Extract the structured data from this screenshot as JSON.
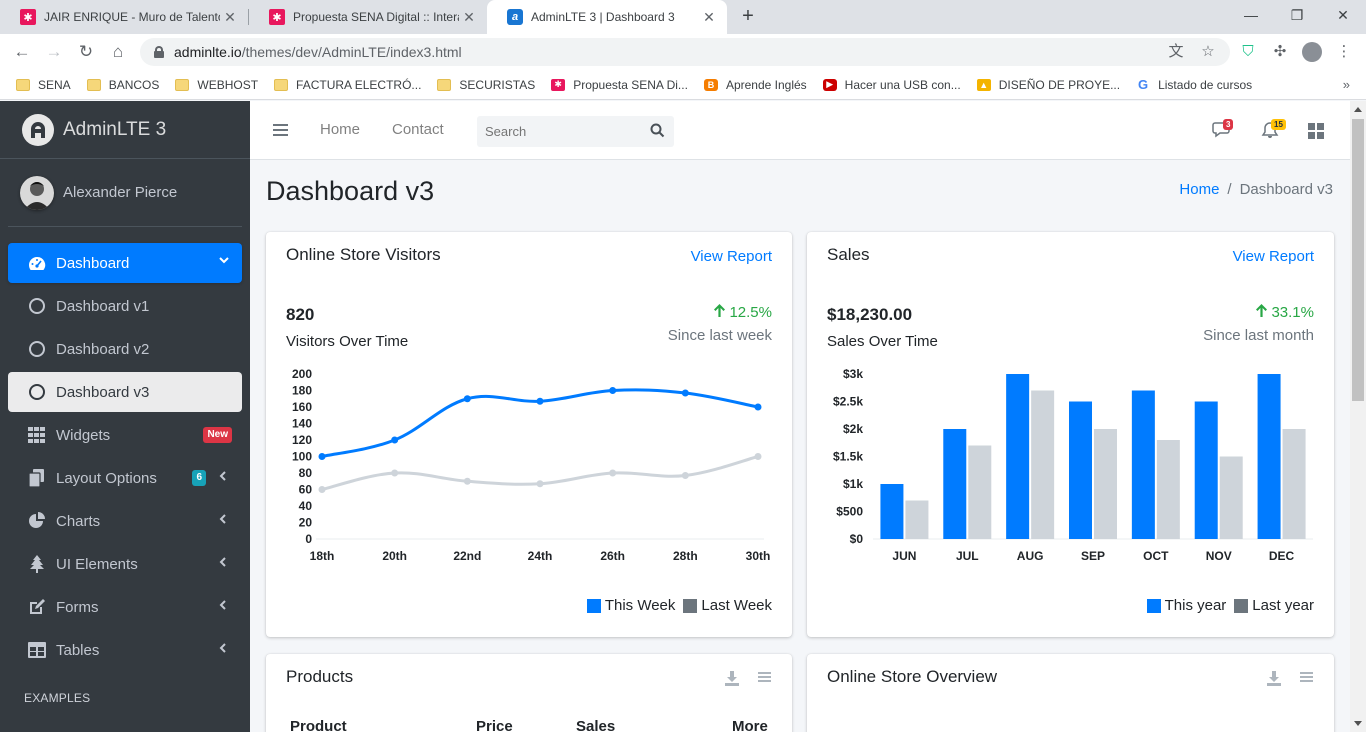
{
  "browser": {
    "tabs": [
      {
        "title": "JAIR ENRIQUE - Muro de Talentos",
        "favicon_color": "#e8175d"
      },
      {
        "title": "Propuesta SENA Digital :: Interacción",
        "favicon_color": "#e8175d"
      },
      {
        "title": "AdminLTE 3 | Dashboard 3",
        "favicon_color": "#1976d2",
        "active": true
      }
    ],
    "url_host": "adminlte.io",
    "url_path": "/themes/dev/AdminLTE/index3.html",
    "bookmarks": [
      {
        "label": "SENA",
        "icon": "folder-icon"
      },
      {
        "label": "BANCOS",
        "icon": "folder-icon"
      },
      {
        "label": "WEBHOST",
        "icon": "folder-icon"
      },
      {
        "label": "FACTURA ELECTRÓ...",
        "icon": "folder-icon"
      },
      {
        "label": "SECURISTAS",
        "icon": "folder-icon"
      },
      {
        "label": "Propuesta SENA Di...",
        "icon": "sena-icon"
      },
      {
        "label": "Aprende Inglés",
        "icon": "blogger-icon"
      },
      {
        "label": "Hacer una USB con...",
        "icon": "youtube-icon"
      },
      {
        "label": "DISEÑO DE PROYE...",
        "icon": "drive-icon"
      },
      {
        "label": "Listado de cursos",
        "icon": "google-icon"
      }
    ]
  },
  "sidebar": {
    "brand": "AdminLTE 3",
    "user": "Alexander Pierce",
    "items": [
      {
        "label": "Dashboard",
        "icon": "tachometer-icon",
        "state": "active-parent"
      },
      {
        "label": "Dashboard v1",
        "icon": "circle-icon"
      },
      {
        "label": "Dashboard v2",
        "icon": "circle-icon"
      },
      {
        "label": "Dashboard v3",
        "icon": "circle-icon",
        "state": "active"
      },
      {
        "label": "Widgets",
        "icon": "th-icon",
        "badge": "New",
        "badge_color": "#dc3545"
      },
      {
        "label": "Layout Options",
        "icon": "copy-icon",
        "badge": "6",
        "badge_color": "#17a2b8"
      },
      {
        "label": "Charts",
        "icon": "pie-chart-icon"
      },
      {
        "label": "UI Elements",
        "icon": "tree-icon"
      },
      {
        "label": "Forms",
        "icon": "edit-icon"
      },
      {
        "label": "Tables",
        "icon": "table-icon"
      }
    ],
    "section_header": "EXAMPLES"
  },
  "navbar": {
    "home": "Home",
    "contact": "Contact",
    "search_placeholder": "Search",
    "messages_count": "3",
    "notifications_count": "15"
  },
  "content": {
    "title": "Dashboard v3",
    "breadcrumb_home": "Home",
    "breadcrumb_current": "Dashboard v3"
  },
  "visitors_card": {
    "title": "Online Store Visitors",
    "link": "View Report",
    "value": "820",
    "value_label": "Visitors Over Time",
    "change": "12.5%",
    "since": "Since last week",
    "legend_this": "This Week",
    "legend_last": "Last Week"
  },
  "sales_card": {
    "title": "Sales",
    "link": "View Report",
    "value": "$18,230.00",
    "value_label": "Sales Over Time",
    "change": "33.1%",
    "since": "Since last month",
    "legend_this": "This year",
    "legend_last": "Last year"
  },
  "products_card": {
    "title": "Products",
    "columns": [
      "Product",
      "Price",
      "Sales",
      "More"
    ]
  },
  "overview_card": {
    "title": "Online Store Overview"
  },
  "colors": {
    "primary": "#007bff",
    "gray": "#ced4da",
    "legend_gray": "#6c757d",
    "success": "#28a745",
    "sidebar": "#343a40"
  },
  "chart_data": [
    {
      "type": "line",
      "categories": [
        "18th",
        "20th",
        "22nd",
        "24th",
        "26th",
        "28th",
        "30th"
      ],
      "series": [
        {
          "name": "This Week",
          "values": [
            100,
            120,
            170,
            167,
            180,
            177,
            160
          ]
        },
        {
          "name": "Last Week",
          "values": [
            60,
            80,
            70,
            67,
            80,
            77,
            100
          ]
        }
      ],
      "yticks": [
        "0",
        "20",
        "40",
        "60",
        "80",
        "100",
        "120",
        "140",
        "160",
        "180",
        "200"
      ],
      "ylim": [
        0,
        200
      ],
      "legend": "bottom-right"
    },
    {
      "type": "bar",
      "categories": [
        "JUN",
        "JUL",
        "AUG",
        "SEP",
        "OCT",
        "NOV",
        "DEC"
      ],
      "series": [
        {
          "name": "This year",
          "values": [
            1000,
            2000,
            3000,
            2500,
            2700,
            2500,
            3000
          ]
        },
        {
          "name": "Last year",
          "values": [
            700,
            1700,
            2700,
            2000,
            1800,
            1500,
            2000
          ]
        }
      ],
      "yticks": [
        "$0",
        "$500",
        "$1k",
        "$1.5k",
        "$2k",
        "$2.5k",
        "$3k"
      ],
      "ylim": [
        0,
        3000
      ],
      "legend": "bottom-right"
    }
  ]
}
